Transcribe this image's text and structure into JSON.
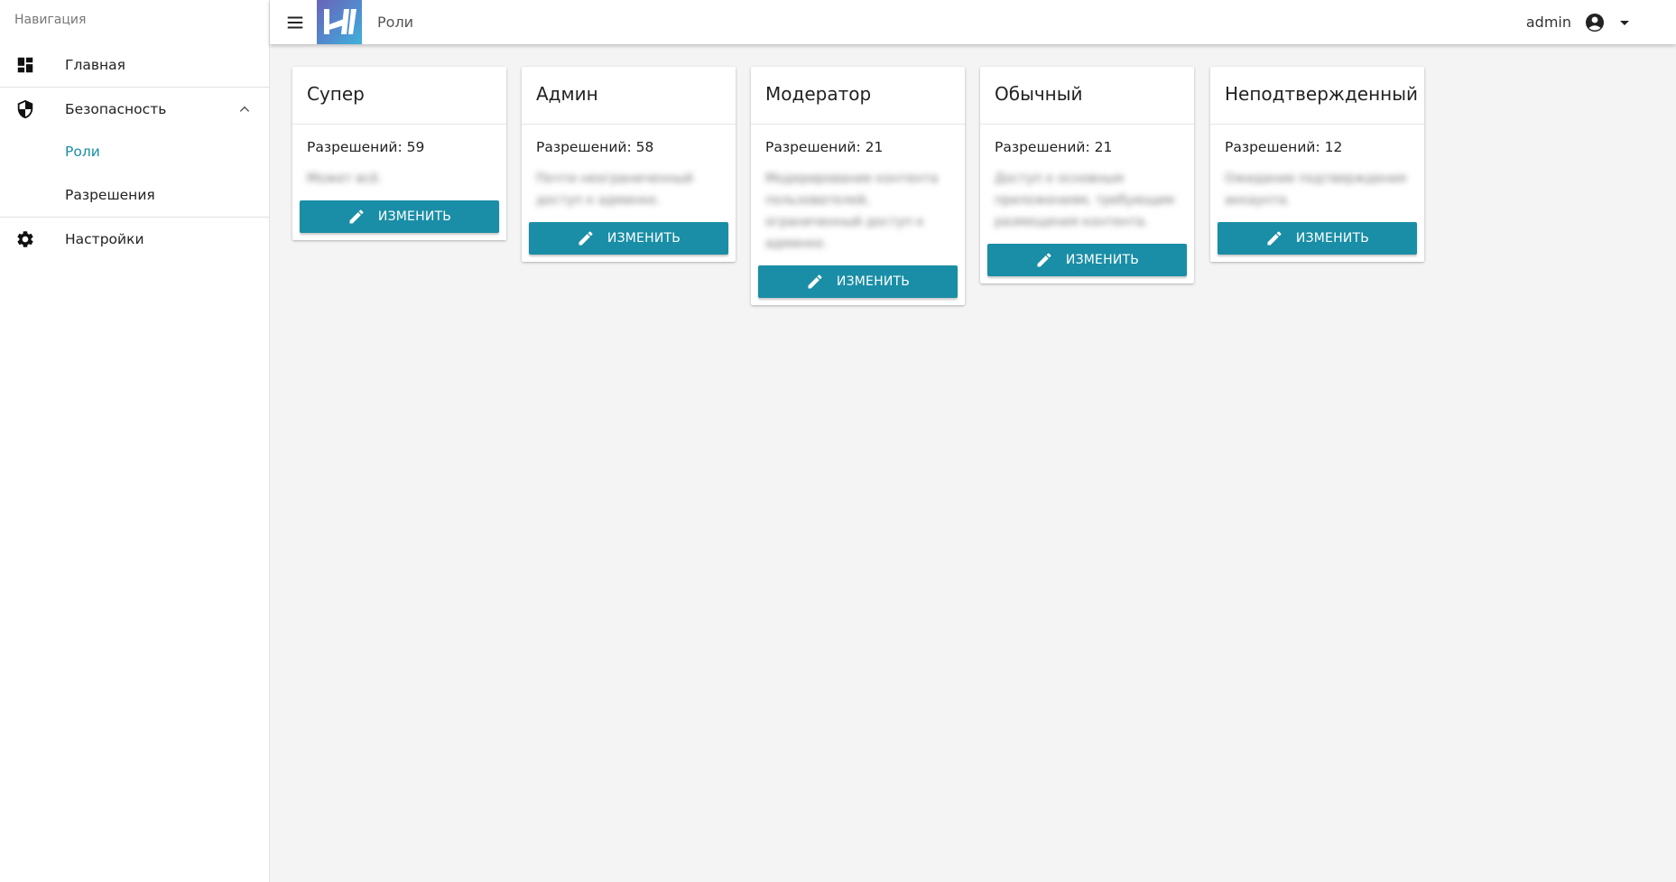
{
  "sidebar": {
    "heading": "Навигация",
    "items": [
      {
        "label": "Главная",
        "icon": "dashboard-icon"
      },
      {
        "label": "Безопасность",
        "icon": "shield-icon",
        "expanded": true
      },
      {
        "label": "Роли",
        "active": true
      },
      {
        "label": "Разрешения"
      },
      {
        "label": "Настройки",
        "icon": "gear-icon"
      }
    ]
  },
  "header": {
    "title": "Роли",
    "user": "admin"
  },
  "roles": [
    {
      "name": "Супер",
      "permissions": "Разрешений: 59",
      "description": "Может всё.",
      "button": "ИЗМЕНИТЬ"
    },
    {
      "name": "Админ",
      "permissions": "Разрешений: 58",
      "description": "Почти неограниченный доступ к админке.",
      "button": "ИЗМЕНИТЬ"
    },
    {
      "name": "Модератор",
      "permissions": "Разрешений: 21",
      "description": "Модерирование контента пользователей, ограниченный доступ к админке.",
      "button": "ИЗМЕНИТЬ"
    },
    {
      "name": "Обычный",
      "permissions": "Разрешений: 21",
      "description": "Доступ к основным приложениям, требующим размещения контента.",
      "button": "ИЗМЕНИТЬ"
    },
    {
      "name": "Неподтвержденный",
      "permissions": "Разрешений: 12",
      "description": "Ожидание подтверждения аккаунта.",
      "button": "ИЗМЕНИТЬ"
    }
  ],
  "colors": {
    "accent": "#1a8ea6",
    "background": "#f4f4f4"
  }
}
